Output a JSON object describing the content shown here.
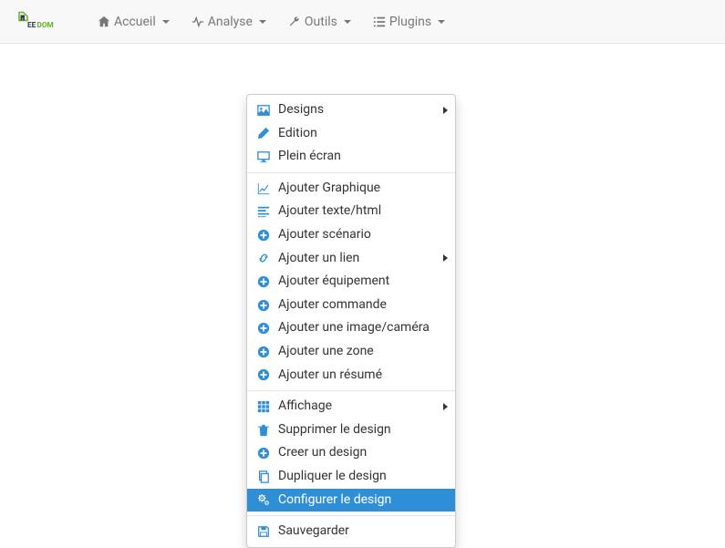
{
  "nav": {
    "accueil": "Accueil",
    "analyse": "Analyse",
    "outils": "Outils",
    "plugins": "Plugins"
  },
  "menu": {
    "designs": "Designs",
    "edition": "Edition",
    "plein_ecran": "Plein écran",
    "ajouter_graphique": "Ajouter Graphique",
    "ajouter_texte": "Ajouter texte/html",
    "ajouter_scenario": "Ajouter scénario",
    "ajouter_lien": "Ajouter un lien",
    "ajouter_equipement": "Ajouter équipement",
    "ajouter_commande": "Ajouter commande",
    "ajouter_image": "Ajouter une image/caméra",
    "ajouter_zone": "Ajouter une zone",
    "ajouter_resume": "Ajouter un résumé",
    "affichage": "Affichage",
    "supprimer": "Supprimer le design",
    "creer": "Creer un design",
    "dupliquer": "Dupliquer le design",
    "configurer": "Configurer le design",
    "sauvegarder": "Sauvegarder"
  }
}
